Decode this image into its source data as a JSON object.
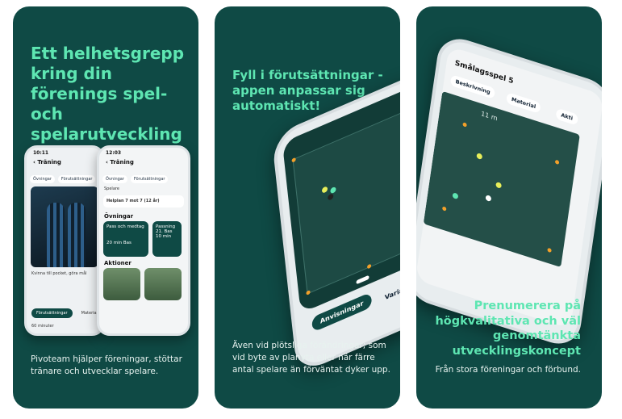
{
  "panels": [
    {
      "headline": "Ett helhetsgrepp kring din förenings spel- och spelarutveckling",
      "caption": "Pivoteam hjälper föreningar, stöttar tränare och utvecklar spelare.",
      "phone_left": {
        "time": "10:11",
        "title": "Träning",
        "chips": [
          "Övningar",
          "Förutsättningar"
        ],
        "image_caption": "Kvinna till pocket, göra mål",
        "pill": "Förutsättningar",
        "pill2": "Material",
        "footer": "60 minuter"
      },
      "phone_right": {
        "time": "12:03",
        "title": "Träning",
        "chips": [
          "Övningar",
          "Förutsättningar"
        ],
        "row": "Helplan 7 mot 7 (12 år)",
        "sub": "Spelare",
        "section1": "Övningar",
        "card1_title": "Pass och medtag",
        "card1_time": "20 min",
        "card1_badge": "Bas",
        "card2_title": "Passning",
        "card2_sub": "21. Bas",
        "card2_time": "10 min",
        "section2": "Aktioner"
      }
    },
    {
      "headline": "Fyll i förutsättningar - appen anpassar sig automatiskt!",
      "caption": "Även vid plötsliga förändringar; som vid byte av planyta eller när färre antal spelare än förväntat dyker upp.",
      "tab_active": "Anvisningar",
      "tab_other": "Variationer"
    },
    {
      "headline": "Prenumerera på högkvalitativa och väl genomtänkta utvecklingskoncept",
      "caption": "Från stora föreningar och förbund.",
      "screen_title": "Smålagsspel 5",
      "tags": [
        "Beskrivning",
        "Material",
        "Akti"
      ],
      "pitch_label": "11 m"
    }
  ],
  "colors": {
    "panel_bg": "#0f4a45",
    "accent": "#5ee6b2",
    "cone": "#f2a02a"
  }
}
